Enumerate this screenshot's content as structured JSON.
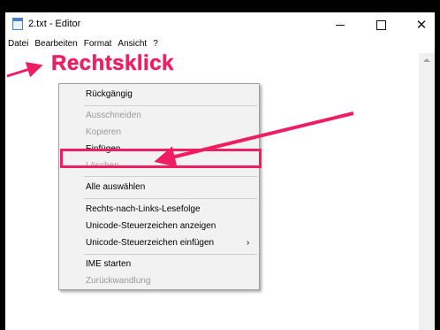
{
  "window": {
    "title": "2.txt - Editor",
    "minimize_icon": "minimize-icon",
    "maximize_icon": "maximize-icon",
    "close_glyph": "✕"
  },
  "menubar": {
    "items": [
      "Datei",
      "Bearbeiten",
      "Format",
      "Ansicht",
      "?"
    ]
  },
  "annotation": {
    "text": "Rechtsklick",
    "color": "#ef1d61"
  },
  "context_menu": {
    "items": [
      {
        "label": "Rückgängig",
        "enabled": true
      },
      {
        "label": "Ausschneiden",
        "enabled": false
      },
      {
        "label": "Kopieren",
        "enabled": false
      },
      {
        "label": "Einfügen",
        "enabled": true,
        "highlighted": true
      },
      {
        "label": "Löschen",
        "enabled": false
      },
      {
        "label": "Alle auswählen",
        "enabled": true
      },
      {
        "label": "Rechts-nach-Links-Lesefolge",
        "enabled": true
      },
      {
        "label": "Unicode-Steuerzeichen anzeigen",
        "enabled": true
      },
      {
        "label": "Unicode-Steuerzeichen einfügen",
        "enabled": true,
        "submenu_arrow": "›"
      },
      {
        "label": "IME starten",
        "enabled": true
      },
      {
        "label": "Zurückwandlung",
        "enabled": false
      }
    ]
  }
}
